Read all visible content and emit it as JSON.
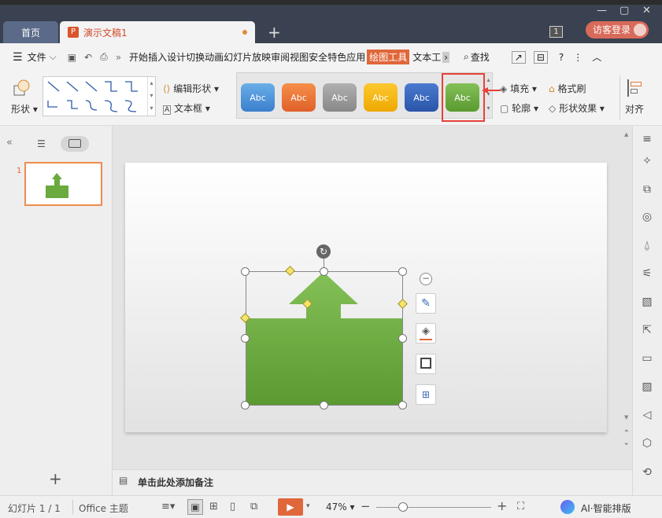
{
  "tabs": {
    "home": "首页",
    "doc": "演示文稿1"
  },
  "titlebar": {
    "badge": "1",
    "login": "访客登录"
  },
  "menu": {
    "file": "文件",
    "items": [
      "开始",
      "插入",
      "设计",
      "切换",
      "动画",
      "幻灯片放映",
      "审阅",
      "视图",
      "安全",
      "特色应用"
    ],
    "active": "绘图工具",
    "next": "文本工",
    "search": "查找"
  },
  "ribbon": {
    "shape": "形状",
    "edit_shape": "编辑形状",
    "text_box": "文本框",
    "style_label": "Abc",
    "fill": "填充",
    "outline": "轮廓",
    "format_painter": "格式刷",
    "shape_effects": "形状效果",
    "align": "对齐",
    "styles": [
      {
        "color": "#4a8fd6"
      },
      {
        "color": "#e8702c"
      },
      {
        "color": "#9a9a9a"
      },
      {
        "color": "#f4b400"
      },
      {
        "color": "#3a66b8"
      },
      {
        "color": "#6aaa3e"
      }
    ]
  },
  "sidebar": {
    "slide_number": "1"
  },
  "notes": {
    "placeholder": "单击此处添加备注"
  },
  "status": {
    "slide": "幻灯片 1 / 1",
    "theme": "Office 主题",
    "zoom": "47%",
    "ai": "AI·智能排版"
  },
  "colors": {
    "accent": "#e0673a",
    "shape_green": "#6aaa3e"
  }
}
